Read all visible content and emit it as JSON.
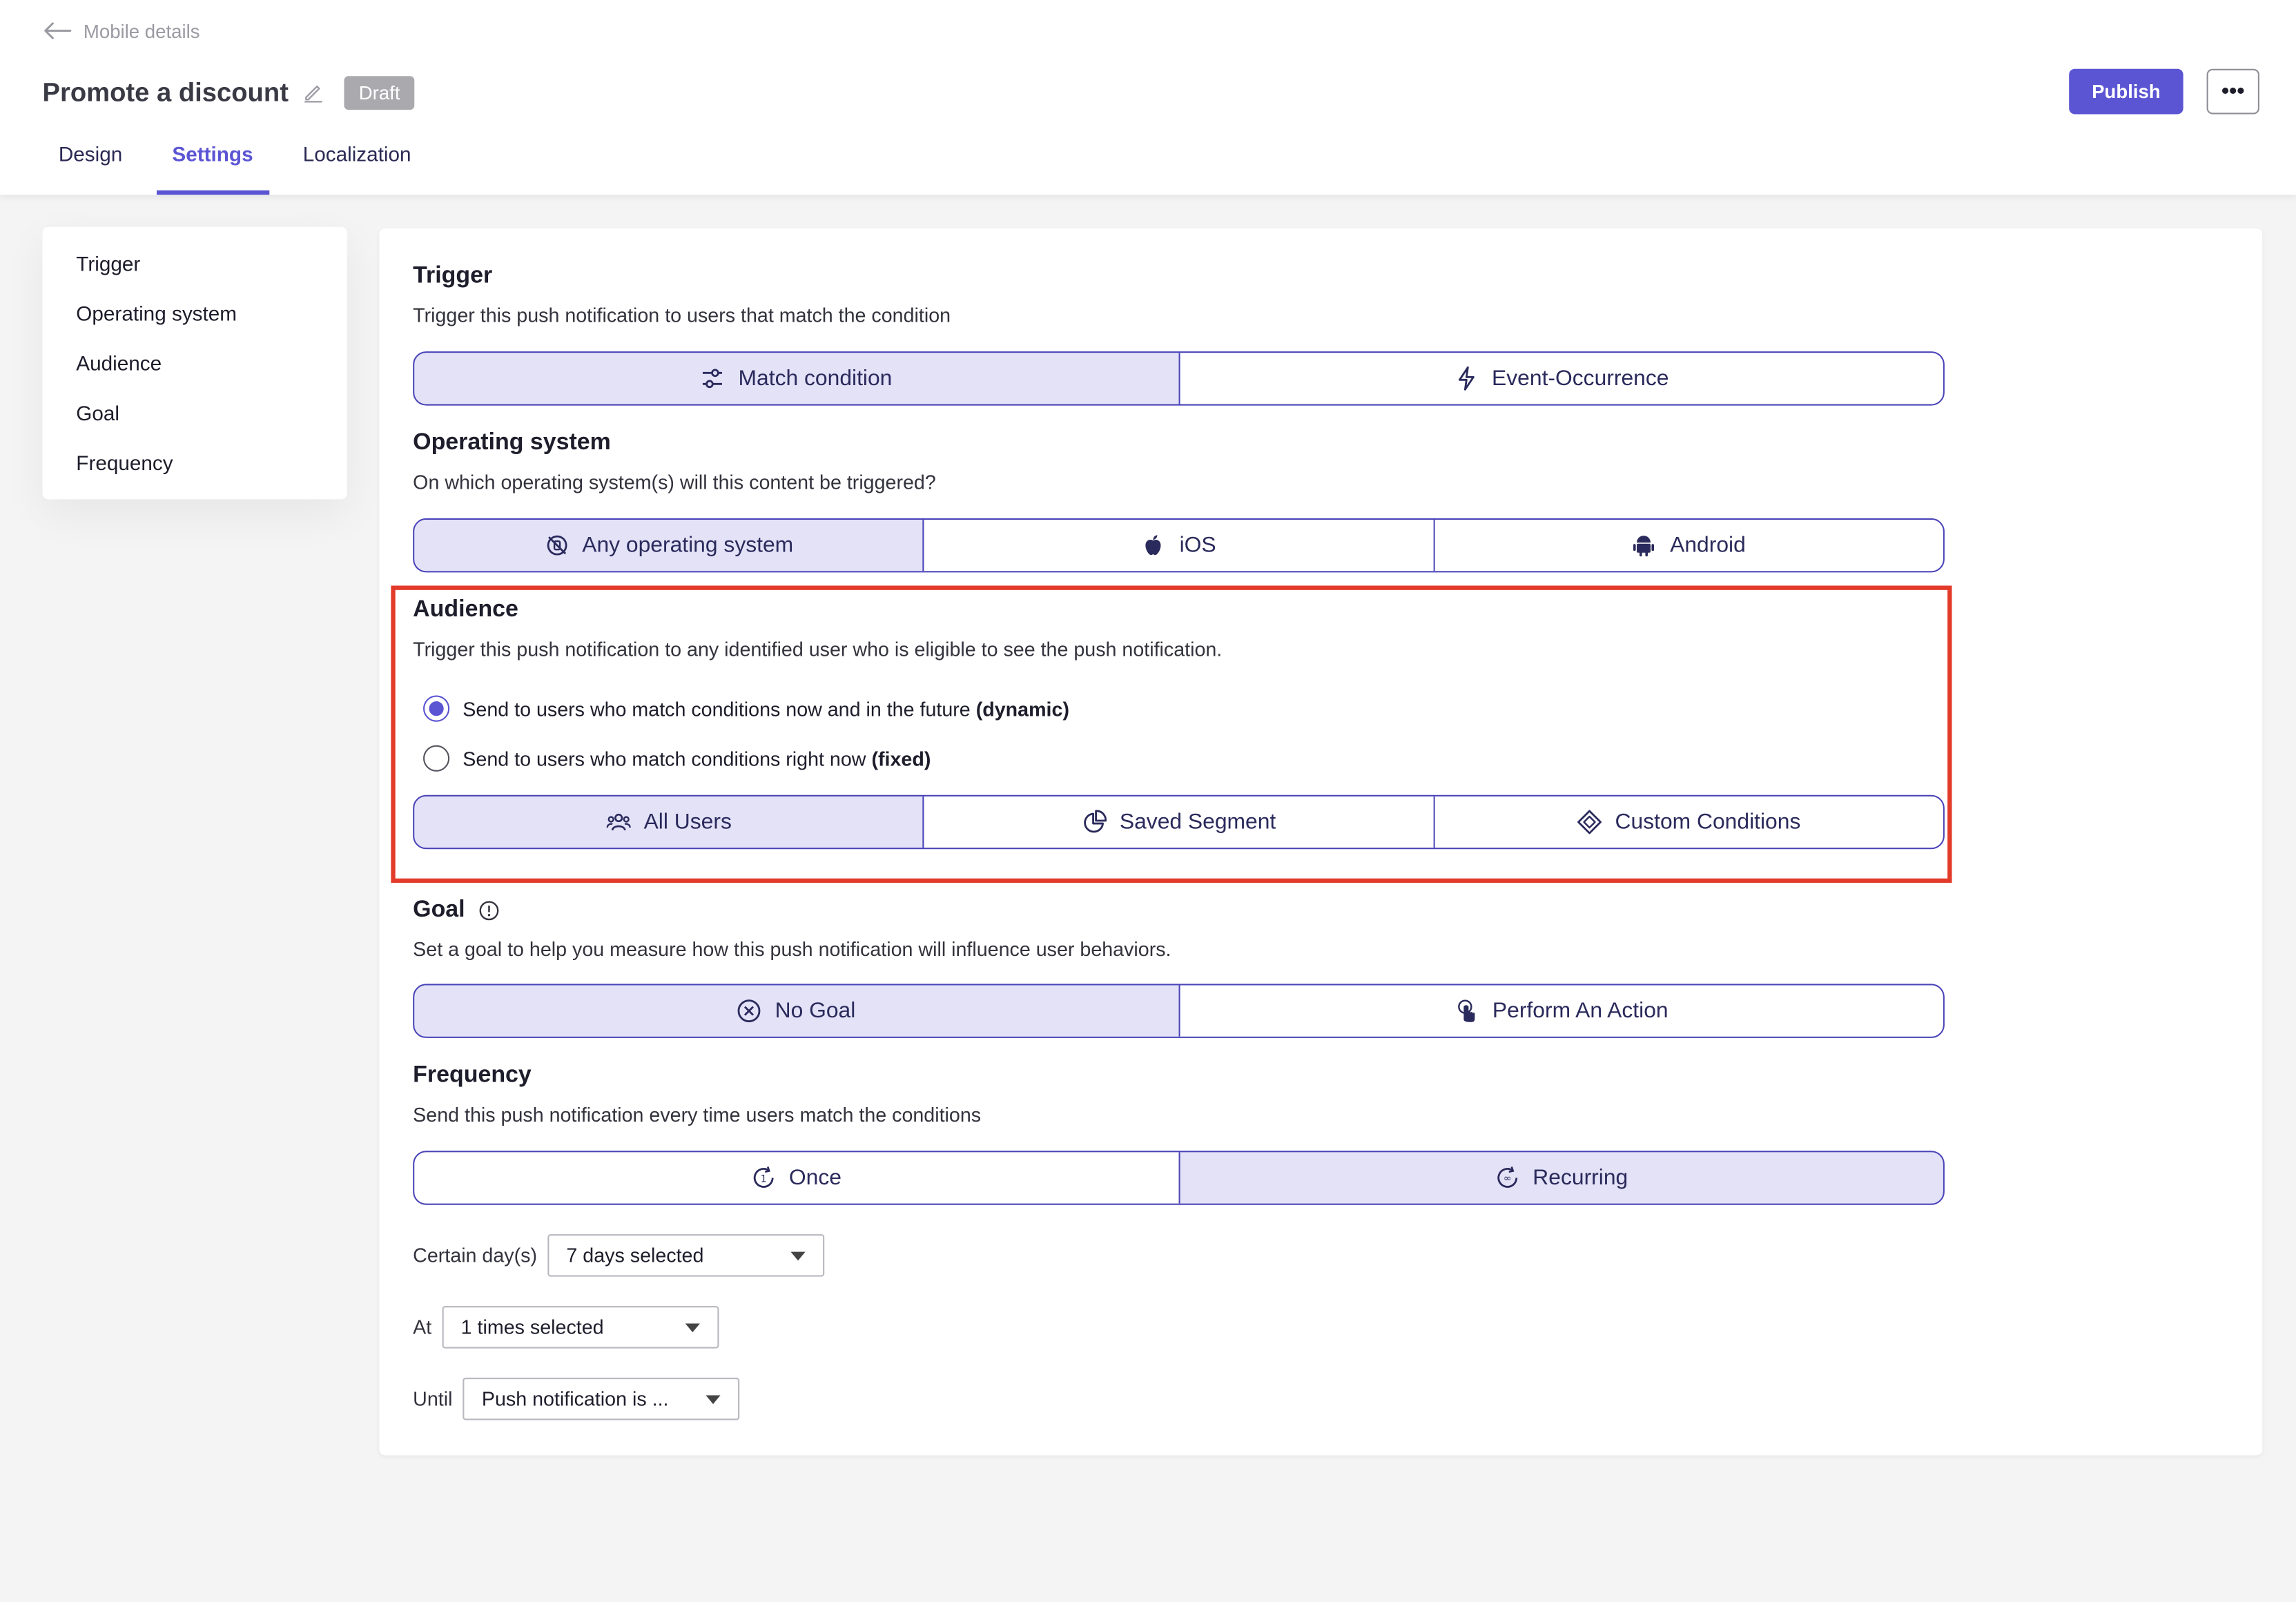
{
  "header": {
    "back_label": "Mobile details",
    "title": "Promote a discount",
    "status_badge": "Draft",
    "publish_label": "Publish",
    "more_label": "•••",
    "tabs": [
      {
        "label": "Design",
        "active": false
      },
      {
        "label": "Settings",
        "active": true
      },
      {
        "label": "Localization",
        "active": false
      }
    ]
  },
  "sidebar": {
    "items": [
      {
        "label": "Trigger"
      },
      {
        "label": "Operating system"
      },
      {
        "label": "Audience"
      },
      {
        "label": "Goal"
      },
      {
        "label": "Frequency"
      }
    ]
  },
  "trigger": {
    "title": "Trigger",
    "description": "Trigger this push notification to users that match the condition",
    "options": [
      {
        "label": "Match condition",
        "icon": "sliders-icon",
        "selected": true
      },
      {
        "label": "Event-Occurrence",
        "icon": "lightning-icon",
        "selected": false
      }
    ]
  },
  "operating_system": {
    "title": "Operating system",
    "description": "On which operating system(s) will this content be triggered?",
    "options": [
      {
        "label": "Any operating system",
        "icon": "devices-icon",
        "selected": true
      },
      {
        "label": "iOS",
        "icon": "apple-icon",
        "selected": false
      },
      {
        "label": "Android",
        "icon": "android-icon",
        "selected": false
      }
    ]
  },
  "audience": {
    "title": "Audience",
    "description": "Trigger this push notification to any identified user who is eligible to see the push notification.",
    "radio_dynamic": {
      "text": "Send to users who match conditions now and in the future",
      "strong": "(dynamic)",
      "checked": true
    },
    "radio_fixed": {
      "text": "Send to users who match conditions right now",
      "strong": "(fixed)",
      "checked": false
    },
    "options": [
      {
        "label": "All Users",
        "icon": "users-icon",
        "selected": true
      },
      {
        "label": "Saved Segment",
        "icon": "pie-chart-icon",
        "selected": false
      },
      {
        "label": "Custom Conditions",
        "icon": "diamond-icon",
        "selected": false
      }
    ]
  },
  "goal": {
    "title": "Goal",
    "description": "Set a goal to help you measure how this push notification will influence user behaviors.",
    "options": [
      {
        "label": "No Goal",
        "icon": "x-circle-icon",
        "selected": true
      },
      {
        "label": "Perform An Action",
        "icon": "tap-icon",
        "selected": false
      }
    ]
  },
  "frequency": {
    "title": "Frequency",
    "description": "Send this push notification every time users match the conditions",
    "options": [
      {
        "label": "Once",
        "icon": "once-icon",
        "selected": false
      },
      {
        "label": "Recurring",
        "icon": "recurring-icon",
        "selected": true
      }
    ],
    "days_label": "Certain day(s)",
    "days_value": "7 days selected",
    "at_label": "At",
    "at_value": "1 times selected",
    "until_label": "Until",
    "until_value": "Push notification is ..."
  },
  "colors": {
    "accent": "#5b55d4",
    "segment_border": "#4a44b8",
    "segment_selected": "#e3e2f7",
    "highlight": "#e33b2a"
  }
}
